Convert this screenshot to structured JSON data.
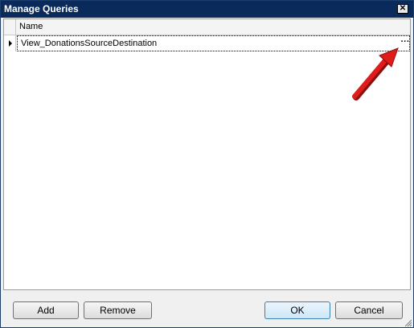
{
  "window": {
    "title": "Manage Queries",
    "close_glyph": "✕"
  },
  "grid": {
    "column_name": "Name",
    "rows": [
      {
        "name": "View_DonationsSourceDestination",
        "ellipsis": "···"
      }
    ]
  },
  "buttons": {
    "add": "Add",
    "remove": "Remove",
    "ok": "OK",
    "cancel": "Cancel"
  },
  "colors": {
    "titlebar": "#0b2a5c",
    "arrow": "#e01b1b"
  }
}
